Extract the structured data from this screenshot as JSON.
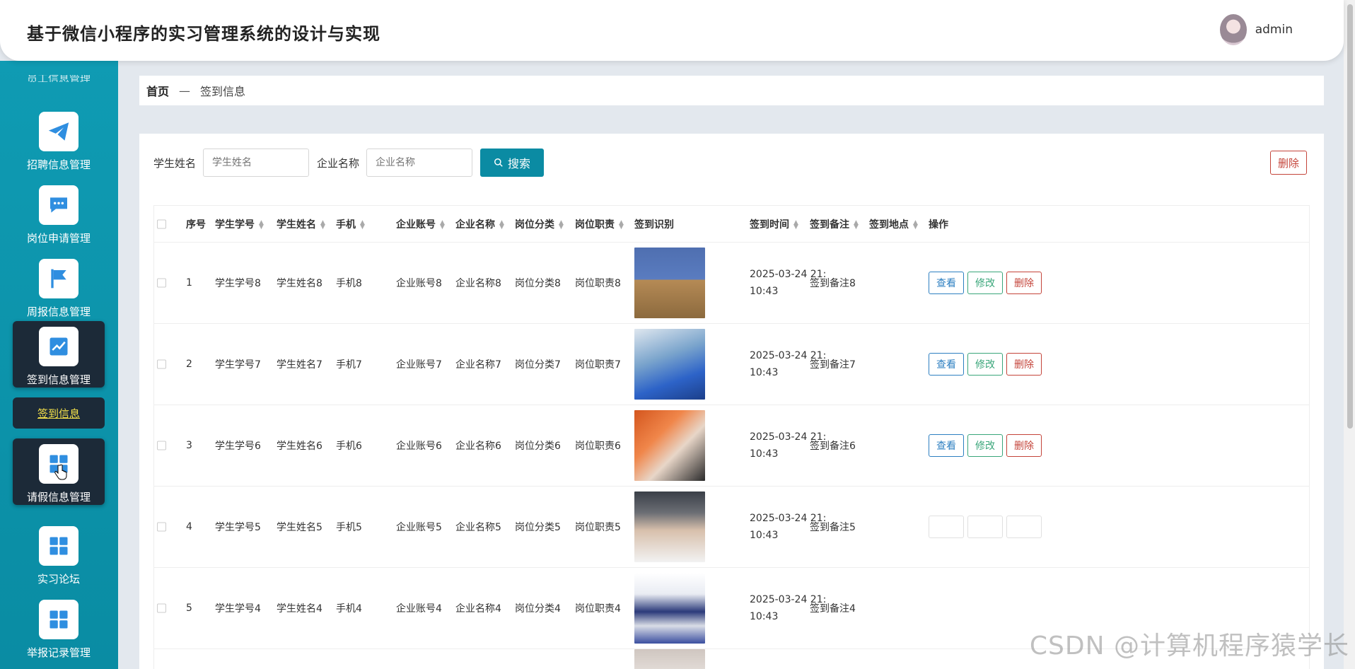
{
  "app": {
    "title": "基于微信小程序的实习管理系统的设计与实现",
    "user": "admin"
  },
  "sidebar": {
    "cut_label": "员工信息管理",
    "items": [
      {
        "label": "招聘信息管理",
        "icon": "paper-plane-icon",
        "active": false
      },
      {
        "label": "岗位申请管理",
        "icon": "chat-icon",
        "active": false
      },
      {
        "label": "周报信息管理",
        "icon": "flag-icon",
        "active": false
      },
      {
        "label": "签到信息管理",
        "icon": "chart-icon",
        "active": true
      },
      {
        "label": "请假信息管理",
        "icon": "grid-icon",
        "active": true
      },
      {
        "label": "实习论坛",
        "icon": "grid-icon",
        "active": false
      },
      {
        "label": "举报记录管理",
        "icon": "grid-icon",
        "active": false
      }
    ],
    "sub_item": "签到信息"
  },
  "breadcrumb": {
    "home": "首页",
    "sep": "—",
    "current": "签到信息"
  },
  "search": {
    "student_name_label": "学生姓名",
    "student_name_placeholder": "学生姓名",
    "company_name_label": "企业名称",
    "company_name_placeholder": "企业名称",
    "search_label": "搜索",
    "delete_label": "删除"
  },
  "table": {
    "headers": [
      "序号",
      "学生学号",
      "学生姓名",
      "手机",
      "企业账号",
      "企业名称",
      "岗位分类",
      "岗位职责",
      "签到识别",
      "签到时间",
      "签到备注",
      "签到地点",
      "操作"
    ],
    "ops": {
      "view": "查看",
      "edit": "修改",
      "delete": "删除"
    },
    "rows": [
      {
        "no": "1",
        "sid": "学生学号8",
        "name": "学生姓名8",
        "phone": "手机8",
        "acct": "企业账号8",
        "company": "企业名称8",
        "category": "岗位分类8",
        "duty": "岗位职责8",
        "time1": "2025-03-24 21:",
        "time2": "10:43",
        "note": "签到备注8",
        "place": ""
      },
      {
        "no": "2",
        "sid": "学生学号7",
        "name": "学生姓名7",
        "phone": "手机7",
        "acct": "企业账号7",
        "company": "企业名称7",
        "category": "岗位分类7",
        "duty": "岗位职责7",
        "time1": "2025-03-24 21:",
        "time2": "10:43",
        "note": "签到备注7",
        "place": ""
      },
      {
        "no": "3",
        "sid": "学生学号6",
        "name": "学生姓名6",
        "phone": "手机6",
        "acct": "企业账号6",
        "company": "企业名称6",
        "category": "岗位分类6",
        "duty": "岗位职责6",
        "time1": "2025-03-24 21:",
        "time2": "10:43",
        "note": "签到备注6",
        "place": ""
      },
      {
        "no": "4",
        "sid": "学生学号5",
        "name": "学生姓名5",
        "phone": "手机5",
        "acct": "企业账号5",
        "company": "企业名称5",
        "category": "岗位分类5",
        "duty": "岗位职责5",
        "time1": "2025-03-24 21:",
        "time2": "10:43",
        "note": "签到备注5",
        "place": ""
      },
      {
        "no": "5",
        "sid": "学生学号4",
        "name": "学生姓名4",
        "phone": "手机4",
        "acct": "企业账号4",
        "company": "企业名称4",
        "category": "岗位分类4",
        "duty": "岗位职责4",
        "time1": "2025-03-24 21:",
        "time2": "10:43",
        "note": "签到备注4",
        "place": ""
      }
    ]
  },
  "watermark": "CSDN @计算机程序猿学长",
  "colors": {
    "sidebar": "#0f9bb3",
    "active": "#1c2a38",
    "primary": "#0b8ba3",
    "danger": "#c4443a",
    "success": "#3aa67a",
    "info": "#2d7fc1"
  }
}
